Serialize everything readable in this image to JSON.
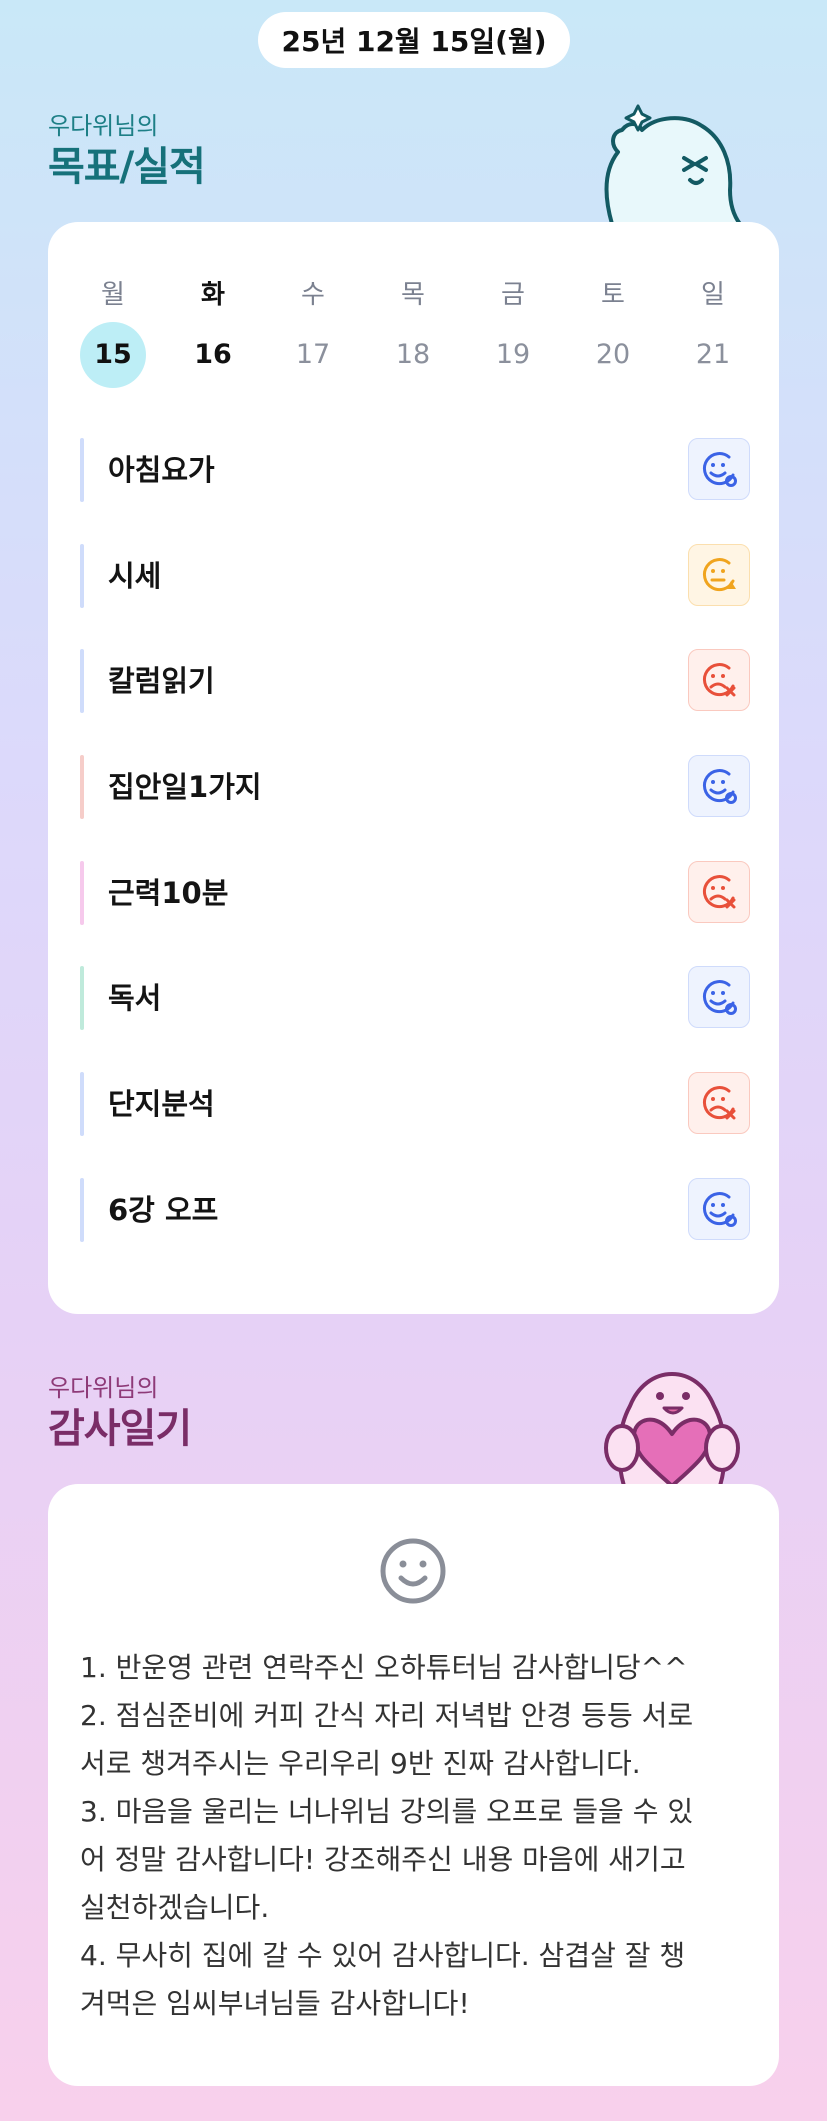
{
  "date_label": "25년 12월 15일(월)",
  "goals_section": {
    "subtitle": "우다위님의",
    "title": "목표/실적"
  },
  "calendar": {
    "days": [
      {
        "name": "월",
        "num": "15",
        "state": "selected"
      },
      {
        "name": "화",
        "num": "16",
        "state": "active"
      },
      {
        "name": "수",
        "num": "17",
        "state": "inactive"
      },
      {
        "name": "목",
        "num": "18",
        "state": "inactive"
      },
      {
        "name": "금",
        "num": "19",
        "state": "inactive"
      },
      {
        "name": "토",
        "num": "20",
        "state": "inactive"
      },
      {
        "name": "일",
        "num": "21",
        "state": "inactive"
      }
    ]
  },
  "goals": [
    {
      "label": "아침요가",
      "status": "done",
      "bar_color": "#cfdcfb"
    },
    {
      "label": "시세",
      "status": "partial",
      "bar_color": "#cfdcfb"
    },
    {
      "label": "칼럼읽기",
      "status": "fail",
      "bar_color": "#cfdcfb"
    },
    {
      "label": "집안일1가지",
      "status": "done",
      "bar_color": "#f6cdc9"
    },
    {
      "label": "근력10분",
      "status": "fail",
      "bar_color": "#f6c9ec"
    },
    {
      "label": "독서",
      "status": "done",
      "bar_color": "#bfeadb"
    },
    {
      "label": "단지분석",
      "status": "fail",
      "bar_color": "#cfdcfb"
    },
    {
      "label": "6강 오프",
      "status": "done",
      "bar_color": "#cfdcfb"
    }
  ],
  "status_colors": {
    "done": {
      "fg": "#3b63e6",
      "bg": "#eef3fe",
      "border": "#cfdbfb"
    },
    "partial": {
      "fg": "#f0a41e",
      "bg": "#fff5e4",
      "border": "#fbdfae"
    },
    "fail": {
      "fg": "#e8503a",
      "bg": "#fff0ec",
      "border": "#fac9bf"
    }
  },
  "gratitude_section": {
    "subtitle": "우다위님의",
    "title": "감사일기"
  },
  "gratitude_lines": [
    "1. 반운영 관련 연락주신 오하튜터님 감사합니당^^",
    "2. 점심준비에 커피 간식 자리 저녁밥 안경 등등 서로",
    "서로 챙겨주시는 우리우리 9반 진짜 감사합니다.",
    "3. 마음을 울리는 너나위님 강의를 오프로 들을 수 있",
    "어 정말 감사합니다! 강조해주신 내용 마음에 새기고",
    "실천하겠습니다.",
    "4. 무사히 집에 갈 수 있어 감사합니다. 삼겹살 잘 챙",
    "겨먹은 임씨부녀님들 감사합니다!"
  ]
}
